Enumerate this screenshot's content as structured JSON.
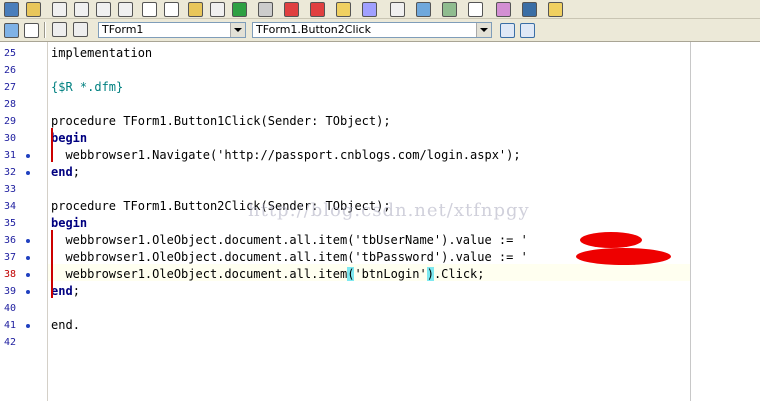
{
  "toolbar": {
    "row1_icons": [
      "new-form-icon",
      "new-unit-icon",
      "open-icon",
      "save-icon",
      "save-all-icon",
      "print-icon",
      "view-unit-icon",
      "view-form-icon",
      "toggle-icon",
      "build-icon",
      "run-icon",
      "pause-icon",
      "trace-icon",
      "step-over-icon",
      "debug-icon",
      "clipboard-icon",
      "component-icon",
      "palette-icon",
      "database-icon",
      "grid-icon",
      "object-icon",
      "help-icon",
      "tip-icon"
    ],
    "form_combo": "TForm1",
    "method_combo": "TForm1.Button2Click"
  },
  "editor": {
    "current_line": "38",
    "watermark": "http://blog.csdn.net/xtfnpgy",
    "lines": [
      {
        "num": "25",
        "text": "implementation",
        "dot": false
      },
      {
        "num": "26",
        "text": "",
        "dot": false
      },
      {
        "num": "27",
        "text": "{$R *.dfm}",
        "dot": false
      },
      {
        "num": "28",
        "text": "",
        "dot": false
      },
      {
        "num": "29",
        "text": "procedure TForm1.Button1Click(Sender: TObject);",
        "dot": false
      },
      {
        "num": "30",
        "text": "begin",
        "dot": false
      },
      {
        "num": "31",
        "text": "  webbrowser1.Navigate('http://passport.cnblogs.com/login.aspx');",
        "dot": true
      },
      {
        "num": "32",
        "text": "end;",
        "dot": true
      },
      {
        "num": "33",
        "text": "",
        "dot": false
      },
      {
        "num": "34",
        "text": "procedure TForm1.Button2Click(Sender: TObject);",
        "dot": false
      },
      {
        "num": "35",
        "text": "begin",
        "dot": false
      },
      {
        "num": "36",
        "text": "  webbrowser1.OleObject.document.all.item('tbUserName').value := '        ';",
        "dot": true
      },
      {
        "num": "37",
        "text": "  webbrowser1.OleObject.document.all.item('tbPassword').value := '             ';",
        "dot": true
      },
      {
        "num": "38",
        "text": "  webbrowser1.OleObject.document.all.item('btnLogin').Click;",
        "dot": true
      },
      {
        "num": "39",
        "text": "end;",
        "dot": true
      },
      {
        "num": "40",
        "text": "",
        "dot": false
      },
      {
        "num": "41",
        "text": "end.",
        "dot": true
      },
      {
        "num": "42",
        "text": "",
        "dot": false
      }
    ]
  }
}
